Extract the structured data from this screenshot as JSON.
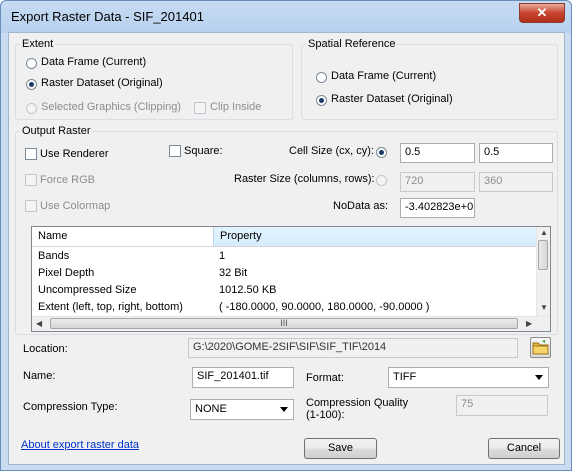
{
  "window": {
    "title": "Export Raster Data - SIF_201401",
    "close_glyph": "✕"
  },
  "extent": {
    "legend": "Extent",
    "options": [
      {
        "label": "Data Frame (Current)",
        "selected": false,
        "enabled": true
      },
      {
        "label": "Raster Dataset (Original)",
        "selected": true,
        "enabled": true
      },
      {
        "label": "Selected Graphics (Clipping)",
        "selected": false,
        "enabled": false
      }
    ],
    "clip_inside": {
      "label": "Clip Inside",
      "checked": false,
      "enabled": false
    }
  },
  "spatial_reference": {
    "legend": "Spatial Reference",
    "options": [
      {
        "label": "Data Frame (Current)",
        "selected": false
      },
      {
        "label": "Raster Dataset (Original)",
        "selected": true
      }
    ]
  },
  "output_raster": {
    "legend": "Output Raster",
    "use_renderer": {
      "label": "Use Renderer",
      "checked": false
    },
    "square": {
      "label": "Square:",
      "checked": false
    },
    "force_rgb": {
      "label": "Force RGB",
      "checked": false,
      "enabled": false
    },
    "use_colormap": {
      "label": "Use Colormap",
      "checked": false,
      "enabled": false
    },
    "cell_size": {
      "label": "Cell Size (cx, cy):",
      "selected": true,
      "cx": "0.5",
      "cy": "0.5"
    },
    "raster_size": {
      "label": "Raster Size (columns, rows):",
      "selected": false,
      "columns": "720",
      "rows": "360"
    },
    "nodata": {
      "label": "NoData as:",
      "value": "-3.402823e+0"
    },
    "properties": {
      "columns": [
        "Name",
        "Property"
      ],
      "rows": [
        {
          "name": "Bands",
          "value": "1"
        },
        {
          "name": "Pixel Depth",
          "value": "32 Bit"
        },
        {
          "name": "Uncompressed Size",
          "value": "1012.50 KB"
        },
        {
          "name": "Extent (left, top, right, bottom)",
          "value": "( -180.0000, 90.0000, 180.0000, -90.0000 )"
        }
      ],
      "hscroll_grip": "III"
    }
  },
  "location": {
    "label": "Location:",
    "value": "G:\\2020\\GOME-2SIF\\SIF\\SIF_TIF\\2014"
  },
  "name": {
    "label": "Name:",
    "value": "SIF_201401.tif"
  },
  "format": {
    "label": "Format:",
    "value": "TIFF"
  },
  "compression_type": {
    "label": "Compression Type:",
    "value": "NONE"
  },
  "compression_quality": {
    "label": "Compression Quality (1-100):",
    "value": "75"
  },
  "help_link": "About export raster data",
  "buttons": {
    "save": "Save",
    "cancel": "Cancel"
  },
  "colors": {
    "accent": "#1a3a6a",
    "link": "#0033cc",
    "close_red": "#c7432d"
  }
}
